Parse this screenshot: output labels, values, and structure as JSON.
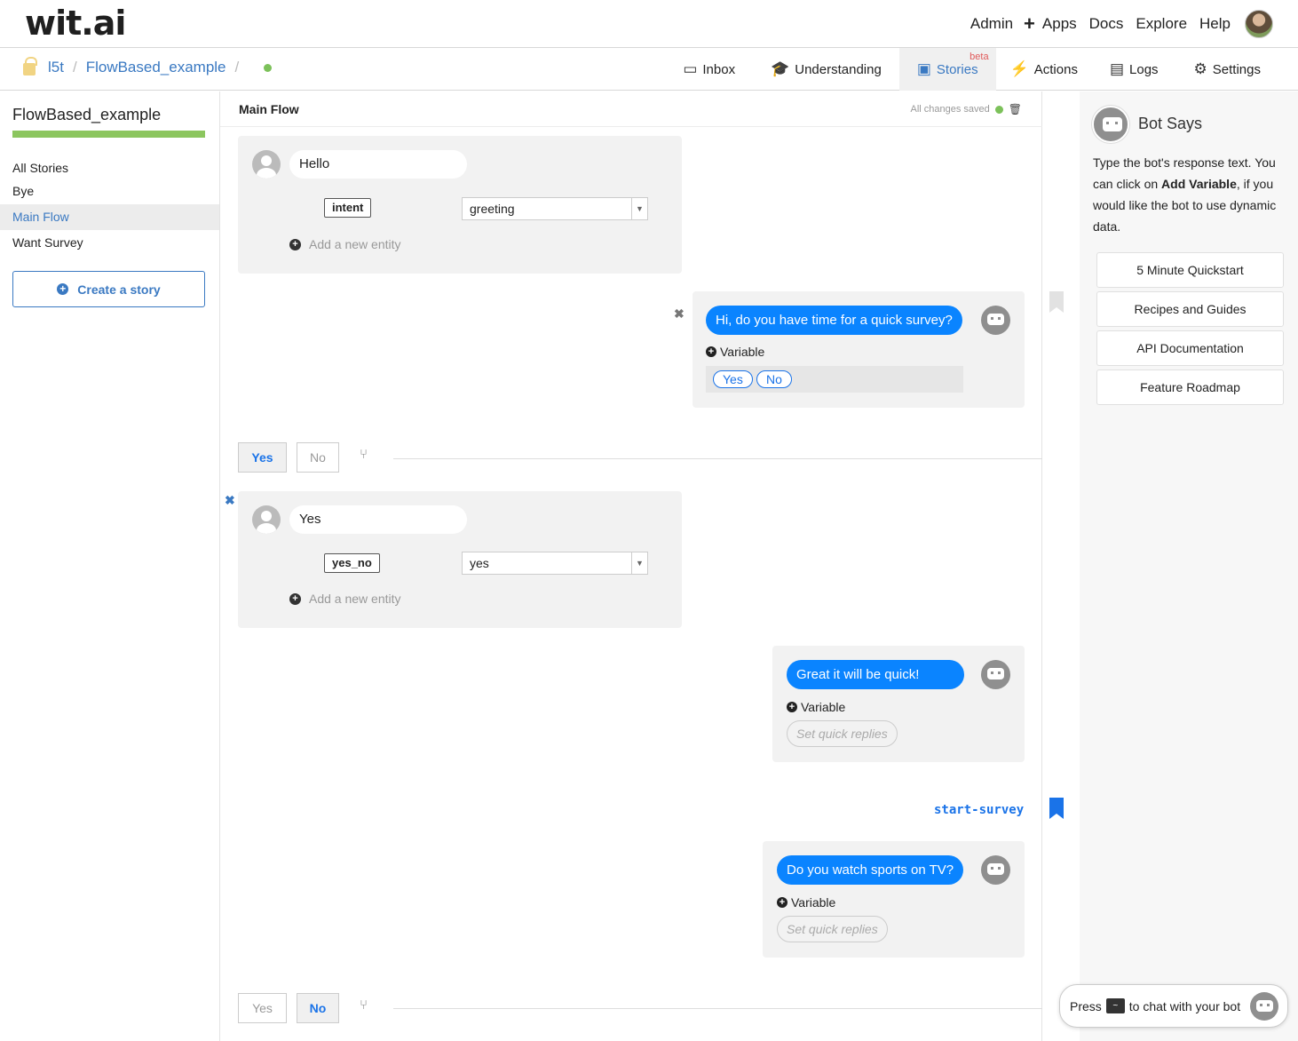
{
  "header": {
    "logo": "wit.ai",
    "nav": [
      "Admin",
      "Apps",
      "Docs",
      "Explore",
      "Help"
    ],
    "add_symbol": "+"
  },
  "subheader": {
    "breadcrumb": {
      "owner": "l5t",
      "app": "FlowBased_example",
      "sep": "/"
    },
    "tabs": [
      {
        "label": "Inbox",
        "icon": "inbox-icon",
        "glyph": "▭"
      },
      {
        "label": "Understanding",
        "icon": "graduation-cap-icon",
        "glyph": "🎓"
      },
      {
        "label": "Stories",
        "icon": "image-icon",
        "glyph": "▣",
        "badge": "beta",
        "active": true
      },
      {
        "label": "Actions",
        "icon": "bolt-icon",
        "glyph": "⚡"
      },
      {
        "label": "Logs",
        "icon": "archive-icon",
        "glyph": "▤"
      },
      {
        "label": "Settings",
        "icon": "gear-icon",
        "glyph": "⚙"
      }
    ]
  },
  "sidebar": {
    "app_name": "FlowBased_example",
    "progress": 1.0,
    "heading": "All Stories",
    "stories": [
      "Bye",
      "Main Flow",
      "Want Survey"
    ],
    "active_story": "Main Flow",
    "create_label": "Create a story"
  },
  "main": {
    "title": "Main Flow",
    "saved_text": "All changes saved",
    "user_turn_1": {
      "text": "Hello",
      "entity": "intent",
      "value": "greeting",
      "add_entity": "Add a new entity"
    },
    "bot_turn_1": {
      "text": "Hi, do you have time for a quick survey?",
      "variable": "Variable",
      "quick_replies": [
        "Yes",
        "No"
      ]
    },
    "branch_1": {
      "options": [
        "Yes",
        "No"
      ],
      "active": "Yes"
    },
    "user_turn_2": {
      "text": "Yes",
      "entity": "yes_no",
      "value": "yes",
      "add_entity": "Add a new entity"
    },
    "bot_turn_2": {
      "text": "Great it will be quick!",
      "variable": "Variable",
      "quick_replies_placeholder": "Set quick replies"
    },
    "bookmark": "start-survey",
    "bot_turn_3": {
      "text": "Do you watch sports on TV?",
      "variable": "Variable",
      "quick_replies_placeholder": "Set quick replies"
    },
    "branch_2": {
      "options": [
        "Yes",
        "No"
      ],
      "active": "No"
    }
  },
  "right_panel": {
    "title": "Bot Says",
    "help_pre": "Type the bot's response text. You can click on ",
    "help_bold": "Add Variable",
    "help_post": ", if you would like the bot to use dynamic data.",
    "links": [
      "5 Minute Quickstart",
      "Recipes and Guides",
      "API Documentation",
      "Feature Roadmap"
    ]
  },
  "chat_prompt": {
    "pre": "Press",
    "key": "~",
    "post": "to chat with your bot"
  },
  "colors": {
    "accent": "#3a79c2",
    "bot_bubble": "#0a84ff",
    "progress": "#8cc65f",
    "beta": "#e05a5a"
  }
}
